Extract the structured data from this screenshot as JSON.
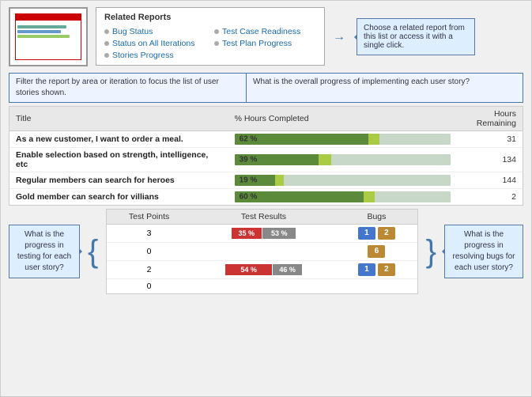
{
  "relatedReports": {
    "title": "Related Reports",
    "tooltip": "Choose a related report from this list or access it with a single click.",
    "items": [
      {
        "label": "Bug Status",
        "col": 0
      },
      {
        "label": "Test Case Readiness",
        "col": 1
      },
      {
        "label": "Status on All Iterations",
        "col": 0
      },
      {
        "label": "Test Plan Progress",
        "col": 1
      },
      {
        "label": "Stories Progress",
        "col": 0
      }
    ]
  },
  "filter": {
    "leftText": "Filter the report by area or iteration to focus the list of user stories shown.",
    "rightText": "What is the overall progress of implementing each user story?"
  },
  "storiesTable": {
    "headers": [
      "Title",
      "% Hours Completed",
      "Hours\nRemaining"
    ],
    "rows": [
      {
        "title": "As a new customer, I want to order a meal.",
        "pct": 62,
        "accent": 5,
        "remaining": "31"
      },
      {
        "title": "Enable selection based on strength, intelligence, etc",
        "pct": 39,
        "accent": 6,
        "remaining": "134"
      },
      {
        "title": "Regular members can search for heroes",
        "pct": 19,
        "accent": 4,
        "remaining": "144"
      },
      {
        "title": "Gold member can search for villians",
        "pct": 60,
        "accent": 5,
        "remaining": "2"
      }
    ]
  },
  "bottomSection": {
    "leftTooltip": "What is the progress in testing for each user story?",
    "rightTooltip": "What is the progress in resolving bugs for each user story?",
    "headers": [
      "Test Points",
      "Test Results",
      "Bugs"
    ],
    "rows": [
      {
        "points": "3",
        "bar1Pct": "35 %",
        "bar1Width": 35,
        "bar2Pct": "53 %",
        "bar2Width": 53,
        "bug1": "1",
        "bug2": "2"
      },
      {
        "points": "0",
        "bar1Pct": "",
        "bar1Width": 0,
        "bar2Pct": "",
        "bar2Width": 0,
        "bug1": "",
        "bug2": "6"
      },
      {
        "points": "2",
        "bar1Pct": "54 %",
        "bar1Width": 54,
        "bar2Pct": "46 %",
        "bar2Width": 46,
        "bug1": "1",
        "bug2": "2"
      },
      {
        "points": "0",
        "bar1Pct": "",
        "bar1Width": 0,
        "bar2Pct": "",
        "bar2Width": 0,
        "bug1": "",
        "bug2": ""
      }
    ]
  }
}
